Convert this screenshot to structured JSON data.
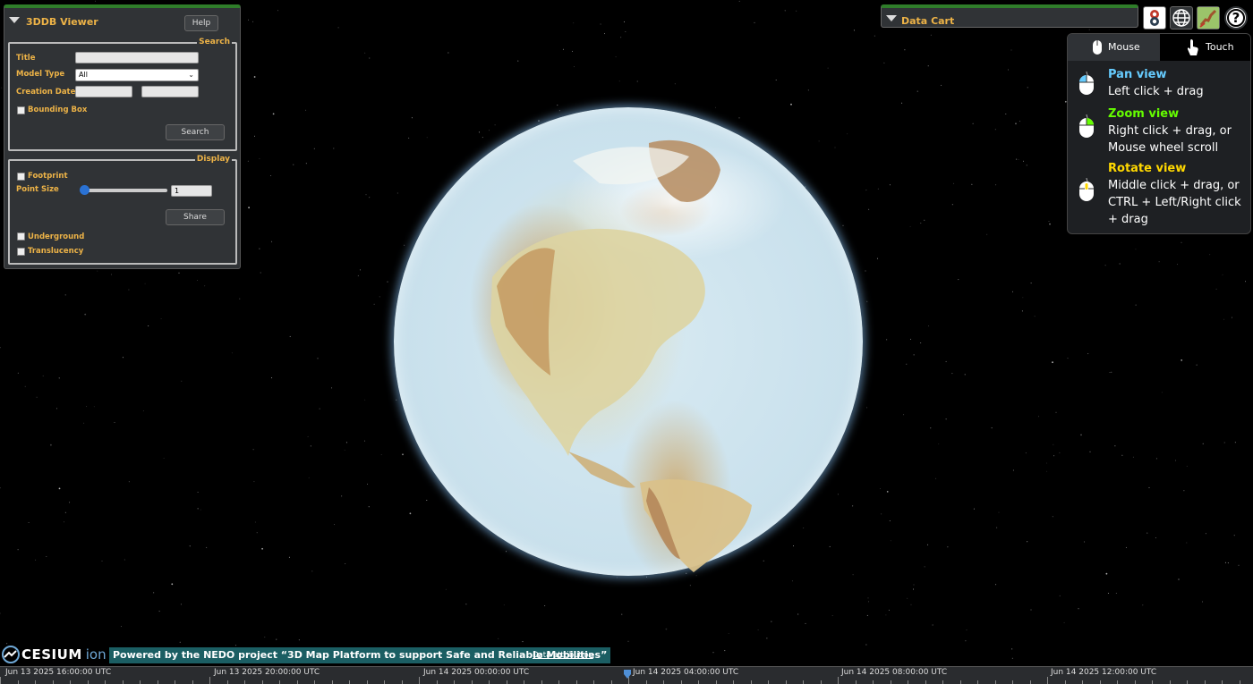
{
  "viewer_panel": {
    "title": "3DDB Viewer",
    "help_label": "Help",
    "search_legend": "Search",
    "title_label": "Title",
    "title_value": "",
    "model_type_label": "Model Type",
    "model_type_value": "All",
    "creation_date_label": "Creation Date",
    "creation_date_from": "",
    "creation_date_to": "",
    "bounding_box_label": "Bounding Box",
    "search_button": "Search",
    "display_legend": "Display",
    "footprint_label": "Footprint",
    "point_size_label": "Point Size",
    "point_size_value": "1",
    "share_button": "Share",
    "underground_label": "Underground",
    "translucency_label": "Translucency"
  },
  "data_cart": {
    "title": "Data Cart"
  },
  "toolbar": {
    "icons": [
      "plateau-logo-icon",
      "globe-icon",
      "japan-map-icon",
      "help-icon"
    ],
    "help_glyph": "?"
  },
  "navigation_help": {
    "tabs": [
      "Mouse",
      "Touch"
    ],
    "active_tab": "Mouse",
    "items": [
      {
        "title": "Pan view",
        "text": "Left click + drag",
        "color": "#66ccff"
      },
      {
        "title": "Zoom view",
        "text": "Right click + drag, or Mouse wheel scroll",
        "color": "#65fd00"
      },
      {
        "title": "Rotate view",
        "text": "Middle click + drag, or CTRL + Left/Right click + drag",
        "color": "#ffd800"
      }
    ]
  },
  "credits": {
    "cesium": "CESIUM",
    "ion": "ion",
    "nedo": "Powered by the NEDO project “3D Map Platform to support Safe and Reliable Mobilities”",
    "attribution_link": "Data attribution"
  },
  "timeline": {
    "labels": [
      "Jun 13 2025 16:00:00 UTC",
      "Jun 13 2025 20:00:00 UTC",
      "Jun 14 2025 00:00:00 UTC",
      "Jun 14 2025 04:00:00 UTC",
      "Jun 14 2025 08:00:00 UTC",
      "Jun 14 2025 12:00:00 UTC"
    ]
  }
}
